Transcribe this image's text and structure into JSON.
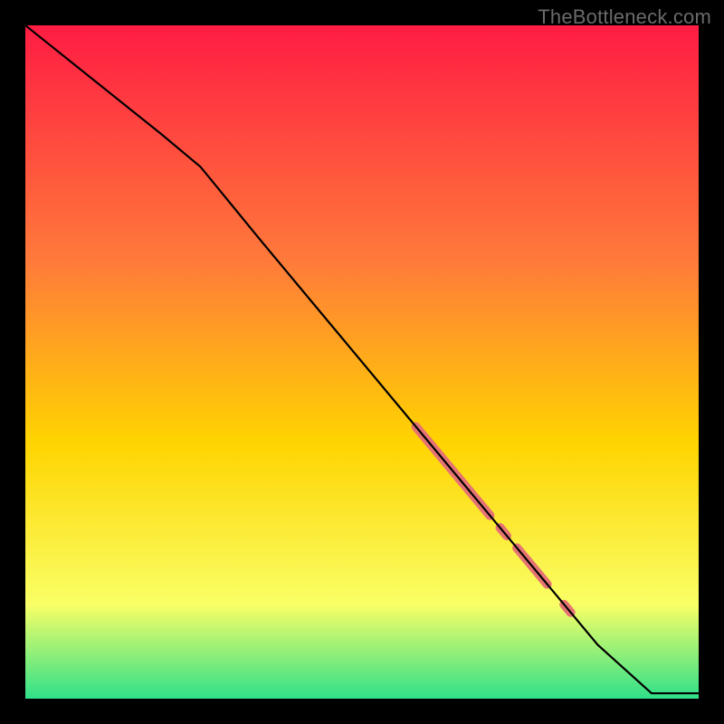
{
  "watermark": "TheBottleneck.com",
  "colors": {
    "frame": "#000000",
    "line": "#000000",
    "marker": "#e57373",
    "gradient_top": "#ff1c43",
    "gradient_mid_upper": "#ff7a3a",
    "gradient_mid": "#ffd400",
    "gradient_mid_lower": "#f9ff66",
    "gradient_bottom": "#2fe08a"
  },
  "chart_data": {
    "type": "line",
    "title": "",
    "xlabel": "",
    "ylabel": "",
    "xlim": [
      0,
      100
    ],
    "ylim": [
      0,
      100
    ],
    "series": [
      {
        "name": "curve",
        "x": [
          0,
          10,
          20,
          26,
          35,
          45,
          55,
          65,
          75,
          85,
          93,
          100
        ],
        "y": [
          100,
          92,
          84,
          79,
          68,
          56,
          44,
          32,
          20,
          8,
          0.8,
          0.8
        ]
      }
    ],
    "highlight_segments": [
      {
        "x0": 58,
        "y0": 40.4,
        "x1": 69,
        "y1": 27.2,
        "width": 10
      },
      {
        "x0": 70.5,
        "y0": 25.4,
        "x1": 71.5,
        "y1": 24.2,
        "width": 10
      },
      {
        "x0": 73,
        "y0": 22.4,
        "x1": 77.5,
        "y1": 17.0,
        "width": 10
      },
      {
        "x0": 80,
        "y0": 14.0,
        "x1": 81,
        "y1": 12.8,
        "width": 10
      }
    ],
    "annotations": []
  }
}
